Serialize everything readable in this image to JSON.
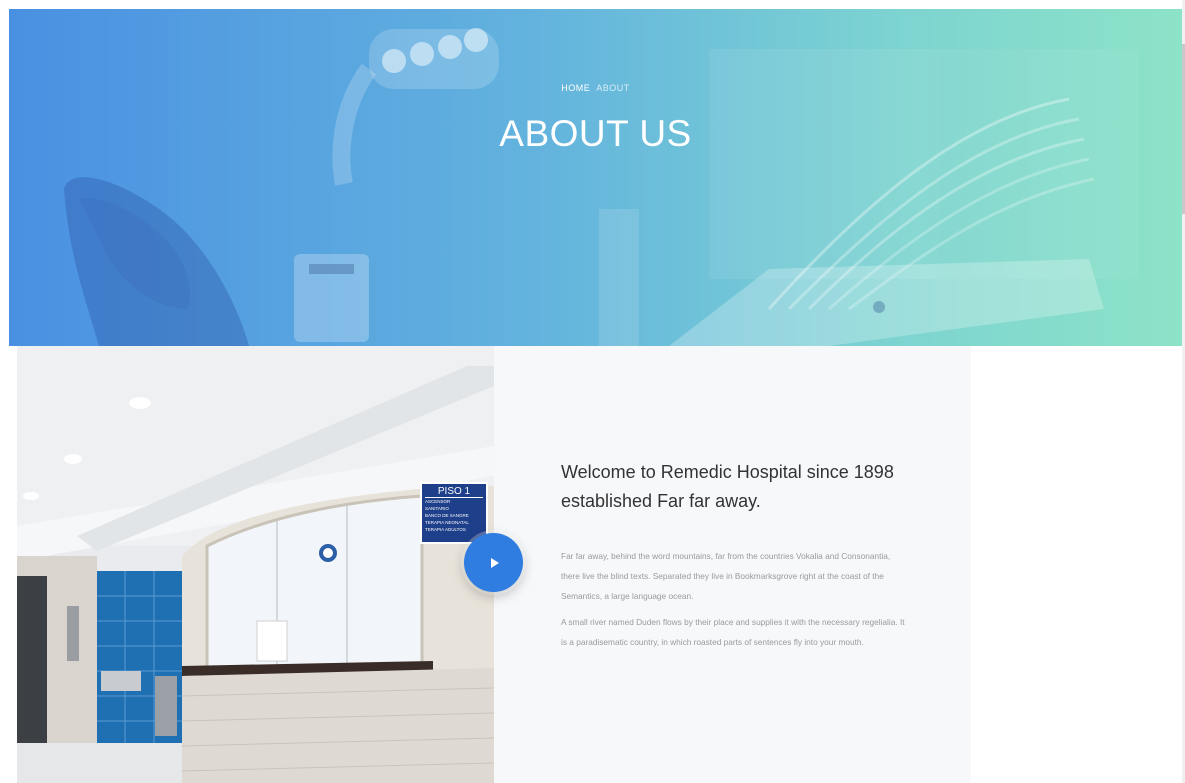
{
  "hero": {
    "breadcrumb": {
      "home": "HOME",
      "current": "ABOUT"
    },
    "title": "ABOUT US",
    "gradient_start": "#4a90e2",
    "gradient_end": "#8de3c7"
  },
  "about": {
    "heading": "Welcome to Remedic Hospital since 1898 established Far far away.",
    "paragraphs": [
      "Far far away, behind the word mountains, far from the countries Vokalia and Consonantia, there live the blind texts. Separated they live in Bookmarksgrove right at the coast of the Semantics, a large language ocean.",
      "A small river named Duden flows by their place and supplies it with the necessary regelialia. It is a paradisematic country, in which roasted parts of sentences fly into your mouth."
    ],
    "sign": {
      "title": "PISO 1",
      "items": [
        "ASCENSOR",
        "SANITARIO",
        "BANCO DE SANGRE",
        "TERAPIA NEONATAL",
        "TERAPIA ADULTOS"
      ]
    },
    "play_icon": "play-icon",
    "accent_color": "#2f7de0"
  }
}
